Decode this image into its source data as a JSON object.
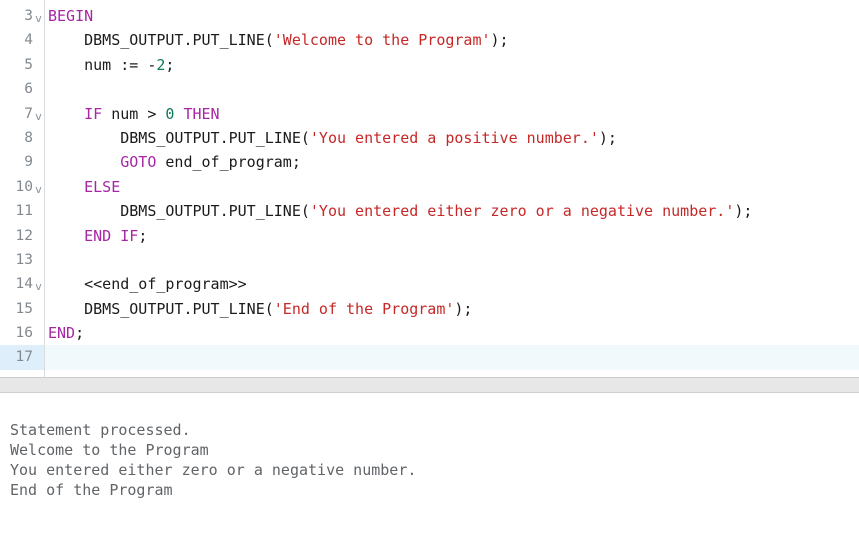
{
  "editor": {
    "gutter_icon": "chevron-down-icon",
    "current_line": 17,
    "lines": [
      {
        "number": "3",
        "foldable": true,
        "tokens": [
          {
            "t": "kw",
            "v": "BEGIN"
          }
        ]
      },
      {
        "number": "4",
        "foldable": false,
        "tokens": [
          {
            "t": "pln",
            "v": "    DBMS_OUTPUT.PUT_LINE("
          },
          {
            "t": "str",
            "v": "'Welcome to the Program'"
          },
          {
            "t": "pln",
            "v": ");"
          }
        ]
      },
      {
        "number": "5",
        "foldable": false,
        "tokens": [
          {
            "t": "pln",
            "v": "    num := -"
          },
          {
            "t": "num",
            "v": "2"
          },
          {
            "t": "pln",
            "v": ";"
          }
        ]
      },
      {
        "number": "6",
        "foldable": false,
        "tokens": []
      },
      {
        "number": "7",
        "foldable": true,
        "tokens": [
          {
            "t": "pln",
            "v": "    "
          },
          {
            "t": "kw",
            "v": "IF"
          },
          {
            "t": "pln",
            "v": " num > "
          },
          {
            "t": "num",
            "v": "0"
          },
          {
            "t": "pln",
            "v": " "
          },
          {
            "t": "kw",
            "v": "THEN"
          }
        ]
      },
      {
        "number": "8",
        "foldable": false,
        "tokens": [
          {
            "t": "pln",
            "v": "        DBMS_OUTPUT.PUT_LINE("
          },
          {
            "t": "str",
            "v": "'You entered a positive number.'"
          },
          {
            "t": "pln",
            "v": ");"
          }
        ]
      },
      {
        "number": "9",
        "foldable": false,
        "tokens": [
          {
            "t": "pln",
            "v": "        "
          },
          {
            "t": "kw",
            "v": "GOTO"
          },
          {
            "t": "pln",
            "v": " end_of_program;"
          }
        ]
      },
      {
        "number": "10",
        "foldable": true,
        "tokens": [
          {
            "t": "pln",
            "v": "    "
          },
          {
            "t": "kw",
            "v": "ELSE"
          }
        ]
      },
      {
        "number": "11",
        "foldable": false,
        "tokens": [
          {
            "t": "pln",
            "v": "        DBMS_OUTPUT.PUT_LINE("
          },
          {
            "t": "str",
            "v": "'You entered either zero or a negative number.'"
          },
          {
            "t": "pln",
            "v": ");"
          }
        ]
      },
      {
        "number": "12",
        "foldable": false,
        "tokens": [
          {
            "t": "pln",
            "v": "    "
          },
          {
            "t": "kw",
            "v": "END IF"
          },
          {
            "t": "pln",
            "v": ";"
          }
        ]
      },
      {
        "number": "13",
        "foldable": false,
        "tokens": []
      },
      {
        "number": "14",
        "foldable": true,
        "tokens": [
          {
            "t": "pln",
            "v": "    <<end_of_program>>"
          }
        ]
      },
      {
        "number": "15",
        "foldable": false,
        "tokens": [
          {
            "t": "pln",
            "v": "    DBMS_OUTPUT.PUT_LINE("
          },
          {
            "t": "str",
            "v": "'End of the Program'"
          },
          {
            "t": "pln",
            "v": ");"
          }
        ]
      },
      {
        "number": "16",
        "foldable": false,
        "tokens": [
          {
            "t": "kw",
            "v": "END"
          },
          {
            "t": "pln",
            "v": ";"
          }
        ]
      },
      {
        "number": "17",
        "foldable": false,
        "tokens": []
      }
    ]
  },
  "output": {
    "lines": [
      "Statement processed.",
      "Welcome to the Program",
      "You entered either zero or a negative number.",
      "End of the Program"
    ]
  },
  "colors": {
    "keyword": "#a626a4",
    "string": "#c62828",
    "number": "#0b7a5a",
    "plain": "#1b1b1b",
    "gutter_text": "#82898f",
    "current_line_bg": "#f2f9fd",
    "splitter_bg": "#e7e7e7",
    "output_text": "#606468"
  }
}
